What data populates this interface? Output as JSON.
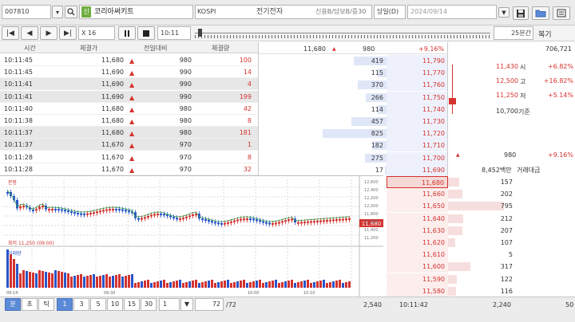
{
  "top": {
    "code": "007810",
    "code_badge": "신",
    "name": "코리아써키트",
    "market": "KOSPI",
    "sector": "전기전자",
    "credit": "신용B/담보B/증30",
    "mode": "당일(D)",
    "date": "2024/09/14"
  },
  "toolbar": {
    "speed": "X 16",
    "time": "10:11",
    "period_value": "25",
    "period_unit": "분간",
    "replay_label": "복기"
  },
  "ticks": {
    "headers": [
      "시간",
      "체결가",
      "전일대비",
      "체결량"
    ],
    "rows": [
      {
        "time": "10:11:45",
        "price": "11,680",
        "change": "980",
        "vol": "100",
        "vcolor": "red",
        "alt": false
      },
      {
        "time": "10:11:45",
        "price": "11,690",
        "change": "990",
        "vol": "14",
        "vcolor": "red",
        "alt": false
      },
      {
        "time": "10:11:41",
        "price": "11,690",
        "change": "990",
        "vol": "4",
        "vcolor": "red",
        "alt": true
      },
      {
        "time": "10:11:41",
        "price": "11,690",
        "change": "990",
        "vol": "199",
        "vcolor": "red",
        "alt": true
      },
      {
        "time": "10:11:40",
        "price": "11,680",
        "change": "980",
        "vol": "42",
        "vcolor": "red",
        "alt": false
      },
      {
        "time": "10:11:38",
        "price": "11,680",
        "change": "980",
        "vol": "8",
        "vcolor": "red",
        "alt": false
      },
      {
        "time": "10:11:37",
        "price": "11,680",
        "change": "980",
        "vol": "181",
        "vcolor": "red",
        "alt": true
      },
      {
        "time": "10:11:37",
        "price": "11,670",
        "change": "970",
        "vol": "1",
        "vcolor": "red",
        "alt": true
      },
      {
        "time": "10:11:28",
        "price": "11,670",
        "change": "970",
        "vol": "8",
        "vcolor": "red",
        "alt": false
      },
      {
        "time": "10:11:28",
        "price": "11,670",
        "change": "970",
        "vol": "32",
        "vcolor": "red",
        "alt": false
      }
    ]
  },
  "book": {
    "header": {
      "price": "11,680",
      "change": "980",
      "pct": "+9.16%"
    },
    "asks": [
      {
        "qty": "419",
        "price": "11,790"
      },
      {
        "qty": "115",
        "price": "11,770"
      },
      {
        "qty": "370",
        "price": "11,760"
      },
      {
        "qty": "266",
        "price": "11,750"
      },
      {
        "qty": "114",
        "price": "11,740"
      },
      {
        "qty": "457",
        "price": "11,730"
      },
      {
        "qty": "825",
        "price": "11,720"
      },
      {
        "qty": "182",
        "price": "11,710"
      },
      {
        "qty": "275",
        "price": "11,700"
      },
      {
        "qty": "17",
        "price": "11,690"
      }
    ],
    "bids": [
      {
        "price": "11,680",
        "qty": "157"
      },
      {
        "price": "11,660",
        "qty": "202"
      },
      {
        "price": "11,650",
        "qty": "795"
      },
      {
        "price": "11,640",
        "qty": "212"
      },
      {
        "price": "11,630",
        "qty": "207"
      },
      {
        "price": "11,620",
        "qty": "107"
      },
      {
        "price": "11,610",
        "qty": "5"
      },
      {
        "price": "11,600",
        "qty": "317"
      },
      {
        "price": "11,590",
        "qty": "122"
      },
      {
        "price": "11,580",
        "qty": "116"
      }
    ]
  },
  "info": {
    "total_vol": "706,721",
    "open_price": "11,430",
    "open_label": "시",
    "open_pct": "+6.82%",
    "high_price": "12,500",
    "high_label": "고",
    "high_pct": "+16.82%",
    "low_price": "11,250",
    "low_label": "저",
    "low_pct": "+5.14%",
    "base_price": "10,700",
    "base_label": "기준",
    "chg_value": "980",
    "chg_pct": "+9.16%",
    "amount": "8,452백만",
    "amount_label": "거래대금"
  },
  "chart": {
    "title": "분봉",
    "low_note": "최저 11,250 (09:00)",
    "vol_label": "거래량",
    "price_ticks": [
      "12,600",
      "12,400",
      "12,200",
      "12,000",
      "11,800",
      "11,600",
      "11,400",
      "11,200"
    ],
    "time_labels": [
      "09:14",
      "09:30",
      "10:00",
      "10:10"
    ],
    "last_price": "11,680"
  },
  "bottom": {
    "tabs": [
      "분",
      "초",
      "틱"
    ],
    "intervals": [
      "1",
      "3",
      "5",
      "10",
      "15",
      "30"
    ],
    "count": "1",
    "page": "72",
    "page_total": "/72",
    "ask_total": "2,540",
    "time": "10:11:42",
    "bid_total": "2,240",
    "right_val": "50"
  }
}
